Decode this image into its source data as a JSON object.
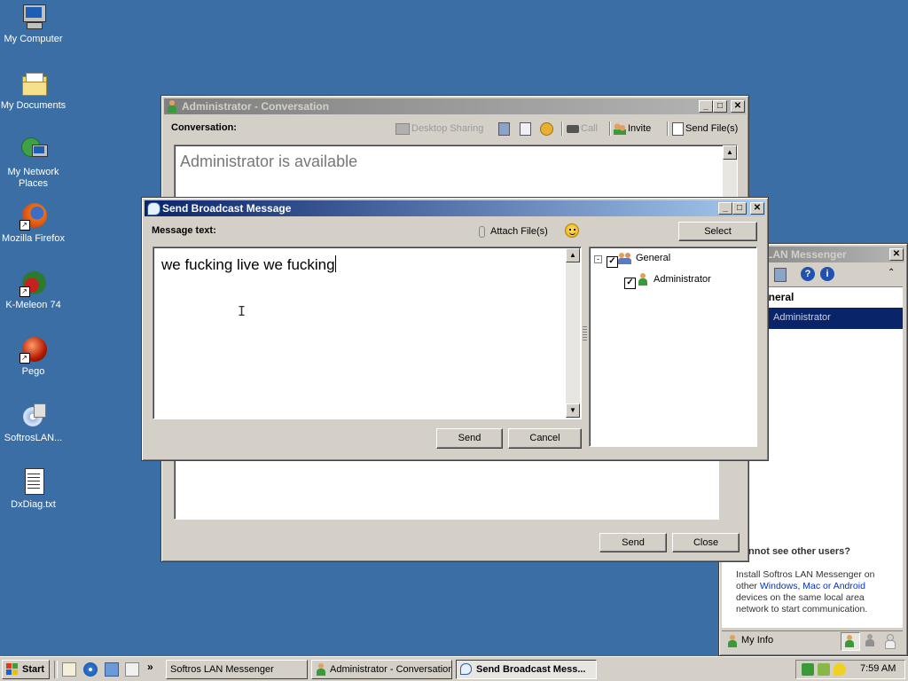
{
  "desktop": {
    "icons": [
      {
        "label": "My Computer",
        "icon": "computer-icon"
      },
      {
        "label": "My Documents",
        "icon": "folder-icon"
      },
      {
        "label": "My Network Places",
        "icon": "network-icon"
      },
      {
        "label": "Mozilla Firefox",
        "icon": "firefox-icon"
      },
      {
        "label": "K-Meleon 74",
        "icon": "kmeleon-icon"
      },
      {
        "label": "Pego",
        "icon": "pego-icon"
      },
      {
        "label": "SoftrosLAN...",
        "icon": "installer-icon"
      },
      {
        "label": "DxDiag.txt",
        "icon": "text-file-icon"
      }
    ]
  },
  "conversation": {
    "title": "Administrator - Conversation",
    "label": "Conversation:",
    "toolbar": {
      "desktop_sharing": "Desktop Sharing",
      "call": "Call",
      "invite": "Invite",
      "send_files": "Send File(s)"
    },
    "status_text": "Administrator is available",
    "send": "Send",
    "close": "Close"
  },
  "messenger": {
    "title": "LAN Messenger",
    "group": "eneral",
    "selected_user": "Administrator",
    "cannot_see_title": "Cannot see other users?",
    "info_before": "Install Softros LAN Messenger on other ",
    "info_link": "Windows, Mac or Android",
    "info_after": " devices on the same local area network to start communication.",
    "my_info": "My Info"
  },
  "broadcast": {
    "title": "Send Broadcast Message",
    "message_label": "Message text:",
    "attach": "Attach File(s)",
    "select": "Select",
    "message_value": "we fucking live we fucking",
    "tree": {
      "group": "General",
      "group_checked": true,
      "user": "Administrator",
      "user_checked": true
    },
    "send": "Send",
    "cancel": "Cancel"
  },
  "taskbar": {
    "start": "Start",
    "tasks": [
      "Softros LAN Messenger",
      "Administrator - Conversation",
      "Send Broadcast Mess..."
    ],
    "active_task": 2,
    "clock": "7:59 AM"
  },
  "colors": {
    "desktop": "#3a6ea5",
    "active_title": "#0a246a",
    "selection": "#0a246a",
    "link": "#0033cc"
  }
}
